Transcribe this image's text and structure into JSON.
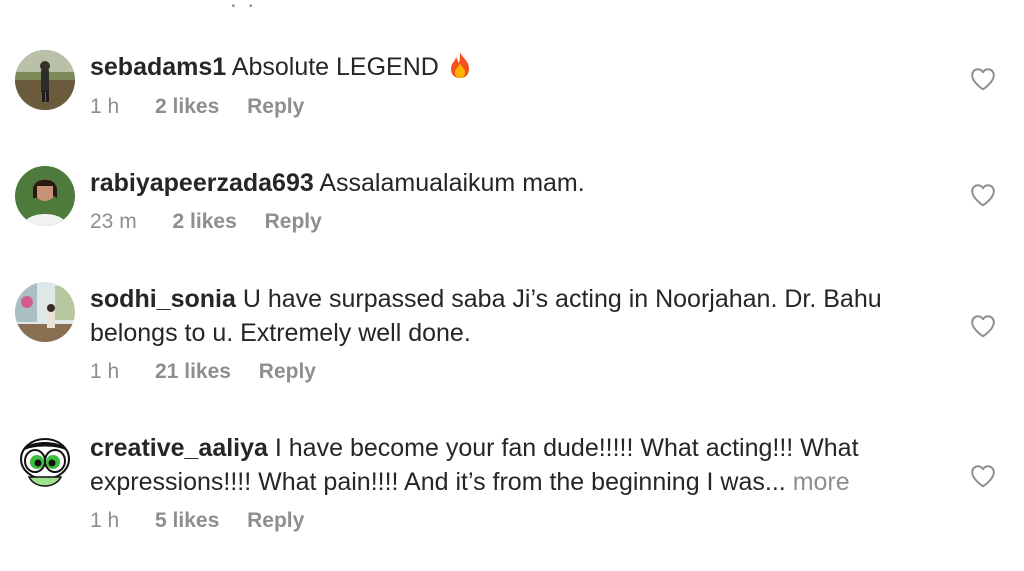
{
  "top_fragment": ". .",
  "comments": [
    {
      "username": "sebadams1",
      "text": "Absolute LEGEND",
      "emoji": "fire-emoji",
      "time": "1 h",
      "likes": "2 likes",
      "reply": "Reply"
    },
    {
      "username": "rabiyapeerzada693",
      "text": "Assalamualaikum mam.",
      "time": "23 m",
      "likes": "2 likes",
      "reply": "Reply"
    },
    {
      "username": "sodhi_sonia",
      "text": "U have surpassed saba Ji’s acting in Noorjahan. Dr. Bahu belongs to u. Extremely well done.",
      "time": "1 h",
      "likes": "21 likes",
      "reply": "Reply"
    },
    {
      "username": "creative_aaliya",
      "text": "I have become your fan dude!!!!! What acting!!! What expressions!!!! What pain!!!! And it’s from the beginning I was...",
      "more": "more",
      "time": "1 h",
      "likes": "5 likes",
      "reply": "Reply"
    }
  ],
  "colors": {
    "text": "#262626",
    "secondary": "#8e8e8e",
    "background": "#ffffff"
  },
  "icons": {
    "like": "heart-outline-icon"
  }
}
